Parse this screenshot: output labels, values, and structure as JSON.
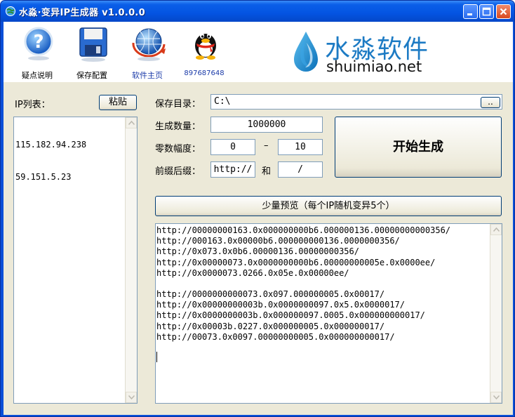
{
  "window": {
    "title": "水淼·变异IP生成器 v1.0.0.0"
  },
  "toolbar": {
    "items": [
      {
        "label": "疑点说明",
        "icon": "help-icon"
      },
      {
        "label": "保存配置",
        "icon": "floppy-disk-icon"
      },
      {
        "label": "软件主页",
        "icon": "globe-icon"
      },
      {
        "label": "897687648",
        "icon": "qq-penguin-icon"
      }
    ]
  },
  "logo": {
    "cn": "水淼软件",
    "en": "shuimiao.net",
    "color": "#1d7bc4"
  },
  "ip_list": {
    "label": "IP列表：",
    "paste_label": "粘贴",
    "items": [
      "115.182.94.238",
      "59.151.5.23"
    ]
  },
  "form": {
    "save_dir_label": "保存目录：",
    "save_dir_value": "C:\\",
    "browse_label": "..",
    "count_label": "生成数量：",
    "count_value": "1000000",
    "zero_label": "零数幅度：",
    "zero_min": "0",
    "zero_sep": "–",
    "zero_max": "10",
    "affix_label": "前缀后缀：",
    "prefix_value": "http://",
    "affix_sep": "和",
    "suffix_value": "/",
    "start_label": "开始生成",
    "preview_label": "少量预览（每个IP随机变异5个）"
  },
  "preview": {
    "group1": [
      "http://00000000163.0x000000000b6.000000136.00000000000356/",
      "http://000163.0x00000b6.000000000136.0000000356/",
      "http://0x073.0x0b6.00000136.00000000356/",
      "http://0x00000073.0x0000000000b6.00000000005e.0x0000ee/",
      "http://0x0000073.0266.0x05e.0x00000ee/"
    ],
    "group2": [
      "http://0000000000073.0x097.000000005.0x00017/",
      "http://0x00000000003b.0x0000000097.0x5.0x0000017/",
      "http://0x0000000003b.0x000000097.0005.0x000000000017/",
      "http://0x00003b.0227.0x000000005.0x000000017/",
      "http://00073.0x0097.00000000005.0x000000000017/"
    ]
  }
}
